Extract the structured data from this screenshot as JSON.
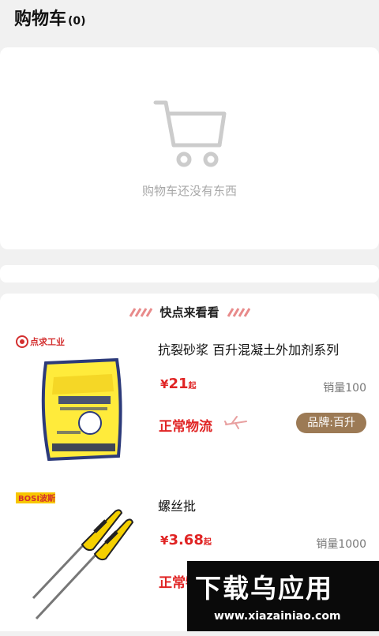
{
  "header": {
    "title": "购物车",
    "count": "(0)"
  },
  "empty_state": {
    "icon": "shopping-cart-icon",
    "message": "购物车还没有东西"
  },
  "recommendations": {
    "heading": "快点来看看",
    "products": [
      {
        "brand_logo_text": "点求工业",
        "image": "concrete-additive-bag",
        "name": "抗裂砂浆 百升混凝土外加剂系列",
        "price_symbol": "¥",
        "price": "21",
        "price_suffix": "起",
        "sales": "销量100",
        "logistics": "正常物流",
        "logistics_icon": "airplane-icon",
        "brand_tag": "品牌:百升"
      },
      {
        "brand_logo_text": "BOSI波斯",
        "image": "yellow-screwdrivers",
        "name": "螺丝批",
        "price_symbol": "¥",
        "price": "3.68",
        "price_suffix": "起",
        "sales": "销量1000",
        "logistics": "正常物流"
      }
    ]
  },
  "watermark": {
    "main_text": "下载乌应用",
    "url": "www.xiazainiao.com"
  },
  "colors": {
    "accent_red": "#e02424",
    "brand_tag_bg": "#9c7a55",
    "page_bg": "#f1f1f1"
  }
}
